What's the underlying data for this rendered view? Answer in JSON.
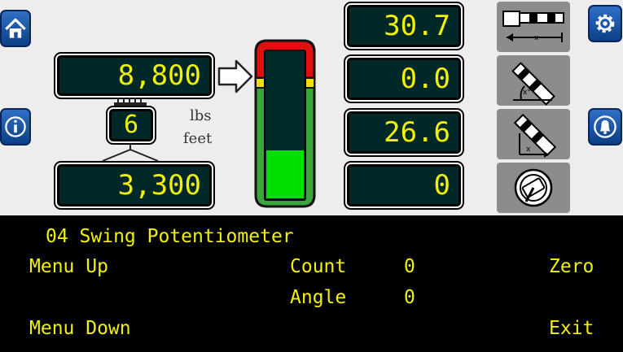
{
  "load_display": {
    "value": "8,800",
    "unit": "lbs"
  },
  "hook_display": {
    "value": "6",
    "unit": "feet"
  },
  "second_load_display": {
    "value": "3,300"
  },
  "right_readouts": [
    {
      "value": "30.7"
    },
    {
      "value": "0.0"
    },
    {
      "value": "26.6"
    },
    {
      "value": "0"
    }
  ],
  "load_bar": {
    "fill_fraction": 0.33,
    "colors": {
      "fill": "#00e000",
      "safe": "#3aa63a",
      "caution": "#f0e000",
      "danger": "#e01010"
    }
  },
  "icons": {
    "home": "home-icon",
    "info": "info-icon",
    "settings": "gear-icon",
    "alarm": "bell-icon",
    "boom_length": "boom-length-icon",
    "boom_angle": "boom-angle-icon",
    "radius": "radius-icon",
    "swing": "swing-icon"
  },
  "menu": {
    "title": "04 Swing Potentiometer",
    "menu_up": "Menu Up",
    "menu_down": "Menu Down",
    "count_label": "Count",
    "count_value": "0",
    "angle_label": "Angle",
    "angle_value": "0",
    "zero": "Zero",
    "exit": "Exit"
  }
}
